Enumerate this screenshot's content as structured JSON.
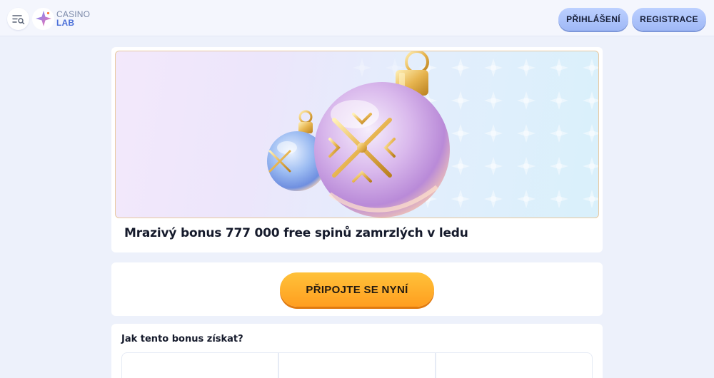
{
  "header": {
    "logo_line1": "CASINO",
    "logo_line2": "LAB",
    "login_label": "PŘIHLÁŠENÍ",
    "register_label": "REGISTRACE"
  },
  "bonus": {
    "title": "Mrazivý bonus 777 000 free spinů zamrzlých v ledu"
  },
  "cta": {
    "label": "PŘIPOJTE SE NYNÍ"
  },
  "how_to": {
    "title": "Jak tento bonus získat?"
  },
  "colors": {
    "accent": "#4a6fd8",
    "cta": "#ffab26",
    "header_button": "#a9c0fa"
  }
}
